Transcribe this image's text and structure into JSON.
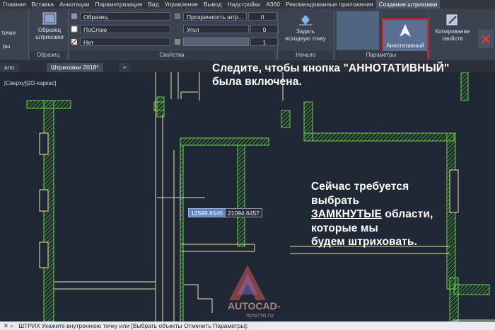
{
  "ribbon_tabs": [
    "Главная",
    "Вставка",
    "Аннотации",
    "Параметризация",
    "Вид",
    "Управление",
    "Вывод",
    "Надстройки",
    "A360",
    "Рекомендованные приложения",
    "Создание штриховки"
  ],
  "ribbon": {
    "points_label": "точки",
    "pattern_button": {
      "line1": "Образец",
      "line2": "штриховки"
    },
    "pattern_panel": "Образец",
    "boundaries_panel": "ры",
    "properties": {
      "pattern_type": "Образец",
      "color": "ПоСлою",
      "background": "Нет",
      "transparency_label": "Прозрачность штр...",
      "transparency_value": "0",
      "angle_label": "Угол",
      "angle_value": "0",
      "scale_value": "1",
      "panel_label": "Свойства"
    },
    "origin": {
      "line1": "Задать",
      "line2": "исходную точку",
      "panel_label": "Начало"
    },
    "annotative_label": "Аннотативный",
    "options_panel": "Параметры",
    "copy_props": {
      "line1": "Копирование",
      "line2": "свойств"
    }
  },
  "file_tabs": {
    "left": "ало",
    "active": "Штриховки 2018*",
    "new": "+"
  },
  "viewport_label": "[Сверху][2D-каркас]",
  "notes": {
    "top_line1": "Следите, чтобы кнопка \"АННОТАТИВНЫЙ\"",
    "top_line2": "была включена.",
    "mid_line1": "Сейчас требуется",
    "mid_line2": "выбрать",
    "mid_line3_u": "ЗАМКНУТЫЕ",
    "mid_line3_rest": " области,",
    "mid_line4": "которые мы",
    "mid_line5": "будем штриховать."
  },
  "coordinates": {
    "x": "12599.8540",
    "y": "21094.6457"
  },
  "command_line": {
    "text": "ШТРИХ Укажите внутреннюю точку или [Выбрать объекты Отменить Параметры]:"
  },
  "watermark": {
    "line1": "AUTOCAD-",
    "line2": "просто.ru"
  },
  "colors": {
    "accent_red": "#e8161b",
    "wall_green": "#5fd83a",
    "line_yellow": "#e6e3a8"
  }
}
